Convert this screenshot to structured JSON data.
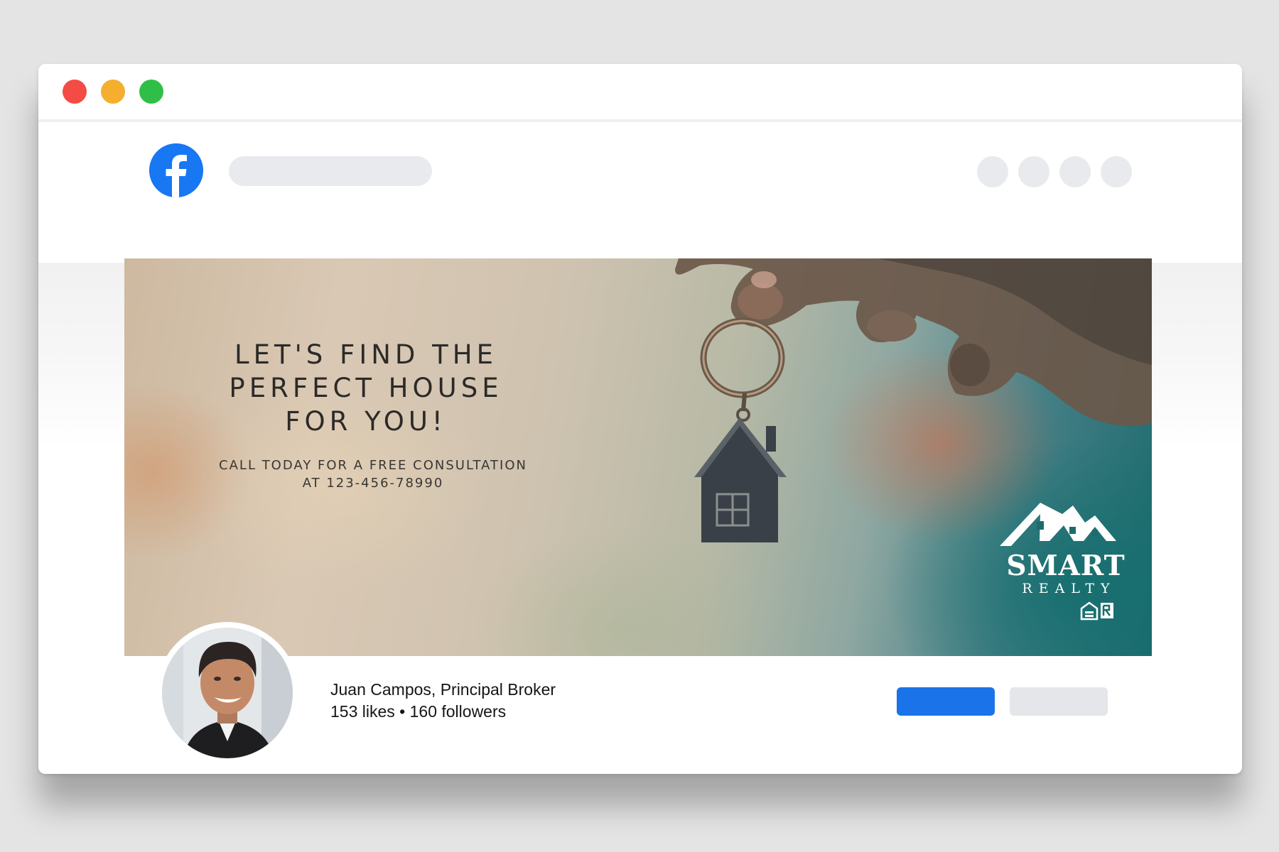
{
  "window": {
    "controls": [
      "close",
      "minimize",
      "maximize"
    ]
  },
  "header": {
    "logo_icon": "facebook-icon",
    "search_placeholder": "",
    "nav_icons": [
      "nav-icon",
      "nav-icon",
      "nav-icon",
      "nav-icon"
    ]
  },
  "cover": {
    "headline": "LET'S FIND THE\nPERFECT HOUSE\nFOR YOU!",
    "cta": "CALL TODAY FOR A FREE CONSULTATION\nAT 123-456-78990",
    "brand_name": "SMART",
    "brand_sub": "REALTY"
  },
  "profile": {
    "name": "Juan Campos, Principal Broker",
    "stats": "153 likes • 160 followers"
  },
  "actions": {
    "primary_label": "",
    "secondary_label": ""
  },
  "colors": {
    "facebook_blue": "#1877f2",
    "primary_button": "#1a73e8",
    "traffic_red": "#f44b45",
    "traffic_yellow": "#f5ae2e",
    "traffic_green": "#2fbf46"
  }
}
